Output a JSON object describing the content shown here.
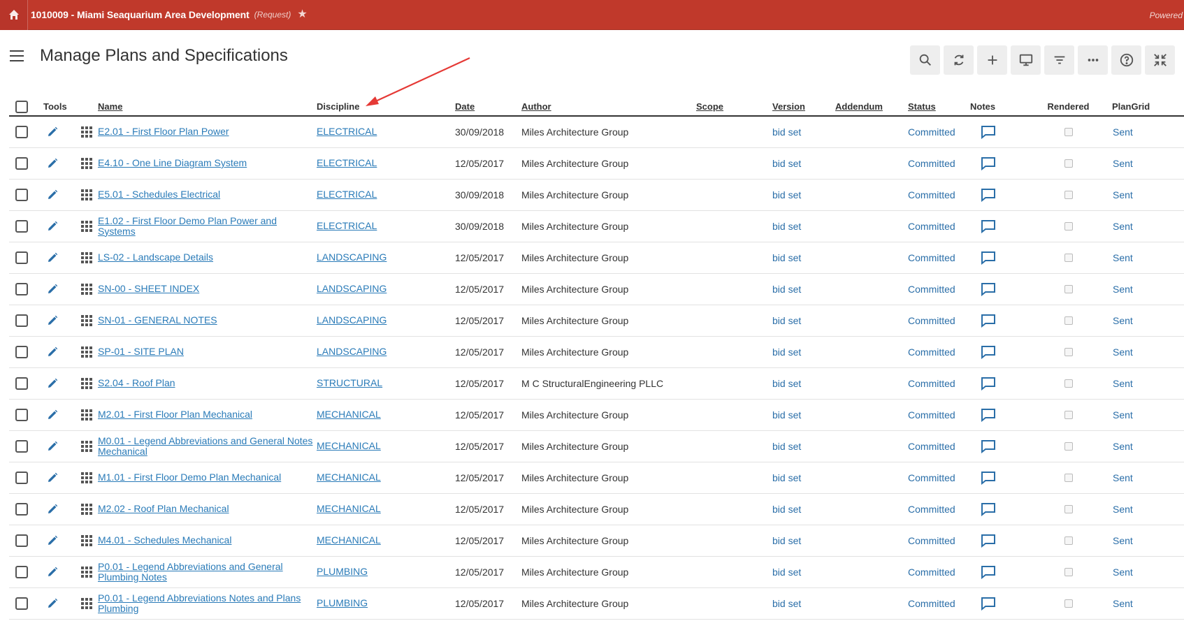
{
  "topbar": {
    "project_title": "1010009 - Miami Seaquarium Area Development",
    "project_status": "(Request)",
    "powered_by": "Powered by"
  },
  "page": {
    "title": "Manage Plans and Specifications"
  },
  "toolbar": {
    "icons": [
      "search-icon",
      "refresh-icon",
      "add-icon",
      "monitor-icon",
      "filter-icon",
      "more-icon",
      "help-icon",
      "collapse-icon"
    ]
  },
  "table": {
    "headers": {
      "tools": "Tools",
      "name": "Name",
      "discipline": "Discipline",
      "date": "Date",
      "author": "Author",
      "scope": "Scope",
      "version": "Version",
      "addendum": "Addendum",
      "status": "Status",
      "notes": "Notes",
      "rendered": "Rendered",
      "plangrid": "PlanGrid"
    },
    "rows": [
      {
        "name": "E2.01 - First Floor Plan Power",
        "discipline": "ELECTRICAL",
        "date": "30/09/2018",
        "author": "Miles Architecture Group",
        "scope": "",
        "version": "bid set",
        "addendum": "",
        "status": "Committed",
        "plangrid": "Sent"
      },
      {
        "name": "E4.10 - One Line Diagram System",
        "discipline": "ELECTRICAL",
        "date": "12/05/2017",
        "author": "Miles Architecture Group",
        "scope": "",
        "version": "bid set",
        "addendum": "",
        "status": "Committed",
        "plangrid": "Sent"
      },
      {
        "name": "E5.01 - Schedules Electrical",
        "discipline": "ELECTRICAL",
        "date": "30/09/2018",
        "author": "Miles Architecture Group",
        "scope": "",
        "version": "bid set",
        "addendum": "",
        "status": "Committed",
        "plangrid": "Sent"
      },
      {
        "name": "E1.02 - First Floor Demo Plan Power and Systems",
        "discipline": "ELECTRICAL",
        "date": "30/09/2018",
        "author": "Miles Architecture Group",
        "scope": "",
        "version": "bid set",
        "addendum": "",
        "status": "Committed",
        "plangrid": "Sent"
      },
      {
        "name": "LS-02 - Landscape Details",
        "discipline": "LANDSCAPING",
        "date": "12/05/2017",
        "author": "Miles Architecture Group",
        "scope": "",
        "version": "bid set",
        "addendum": "",
        "status": "Committed",
        "plangrid": "Sent"
      },
      {
        "name": "SN-00 - SHEET INDEX",
        "discipline": "LANDSCAPING",
        "date": "12/05/2017",
        "author": "Miles Architecture Group",
        "scope": "",
        "version": "bid set",
        "addendum": "",
        "status": "Committed",
        "plangrid": "Sent"
      },
      {
        "name": "SN-01 - GENERAL NOTES",
        "discipline": "LANDSCAPING",
        "date": "12/05/2017",
        "author": "Miles Architecture Group",
        "scope": "",
        "version": "bid set",
        "addendum": "",
        "status": "Committed",
        "plangrid": "Sent"
      },
      {
        "name": "SP-01 - SITE PLAN",
        "discipline": "LANDSCAPING",
        "date": "12/05/2017",
        "author": "Miles Architecture Group",
        "scope": "",
        "version": "bid set",
        "addendum": "",
        "status": "Committed",
        "plangrid": "Sent"
      },
      {
        "name": "S2.04 - Roof Plan",
        "discipline": "STRUCTURAL",
        "date": "12/05/2017",
        "author": "M C StructuralEngineering PLLC",
        "scope": "",
        "version": "bid set",
        "addendum": "",
        "status": "Committed",
        "plangrid": "Sent"
      },
      {
        "name": "M2.01 - First Floor Plan Mechanical",
        "discipline": "MECHANICAL",
        "date": "12/05/2017",
        "author": "Miles Architecture Group",
        "scope": "",
        "version": "bid set",
        "addendum": "",
        "status": "Committed",
        "plangrid": "Sent"
      },
      {
        "name": "M0.01 - Legend Abbreviations and General Notes Mechanical",
        "discipline": "MECHANICAL",
        "date": "12/05/2017",
        "author": "Miles Architecture Group",
        "scope": "",
        "version": "bid set",
        "addendum": "",
        "status": "Committed",
        "plangrid": "Sent"
      },
      {
        "name": "M1.01 - First Floor Demo Plan Mechanical",
        "discipline": "MECHANICAL",
        "date": "12/05/2017",
        "author": "Miles Architecture Group",
        "scope": "",
        "version": "bid set",
        "addendum": "",
        "status": "Committed",
        "plangrid": "Sent"
      },
      {
        "name": "M2.02 - Roof Plan Mechanical",
        "discipline": "MECHANICAL",
        "date": "12/05/2017",
        "author": "Miles Architecture Group",
        "scope": "",
        "version": "bid set",
        "addendum": "",
        "status": "Committed",
        "plangrid": "Sent"
      },
      {
        "name": "M4.01 - Schedules Mechanical",
        "discipline": "MECHANICAL",
        "date": "12/05/2017",
        "author": "Miles Architecture Group",
        "scope": "",
        "version": "bid set",
        "addendum": "",
        "status": "Committed",
        "plangrid": "Sent"
      },
      {
        "name": "P0.01 - Legend Abbreviations and General Plumbing Notes",
        "discipline": "PLUMBING",
        "date": "12/05/2017",
        "author": "Miles Architecture Group",
        "scope": "",
        "version": "bid set",
        "addendum": "",
        "status": "Committed",
        "plangrid": "Sent"
      },
      {
        "name": "P0.01 - Legend Abbreviations Notes and Plans Plumbing",
        "discipline": "PLUMBING",
        "date": "12/05/2017",
        "author": "Miles Architecture Group",
        "scope": "",
        "version": "bid set",
        "addendum": "",
        "status": "Committed",
        "plangrid": "Sent"
      }
    ]
  },
  "colors": {
    "topbar": "#c0392b",
    "link": "#2a7bb8",
    "annotation": "#e53935"
  }
}
